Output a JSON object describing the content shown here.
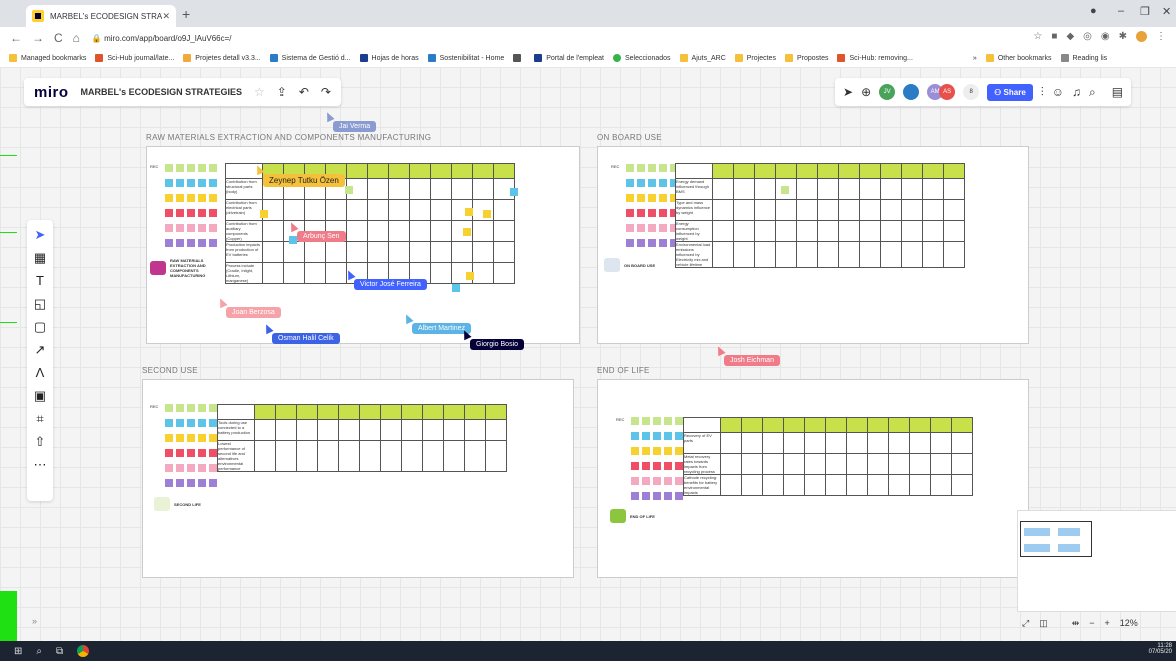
{
  "browser": {
    "tab_title": "MARBEL's ECODESIGN STRATEG",
    "url": "miro.com/app/board/o9J_lAuV66c=/",
    "bookmarks": [
      "Managed bookmarks",
      "Sci-Hub journal/late...",
      "Projetes detall v3.3...",
      "Sistema de Gestió d...",
      "Hojas de horas",
      "Sostenibilitat - Home",
      "Portal de l'empleat",
      "Seleccionados",
      "Ajuts_ARC",
      "Projectes",
      "Propostes",
      "Sci-Hub: removing..."
    ],
    "bookmarks_right": [
      "»",
      "Other bookmarks",
      "Reading lis"
    ]
  },
  "miro": {
    "logo": "miro",
    "board_name": "MARBEL's ECODESIGN STRATEGIES",
    "share_label": "Share",
    "collab_count": "8",
    "collab_initials": [
      "JV",
      "AM",
      "AS"
    ],
    "zoom_level": "12%"
  },
  "frames": {
    "raw": "RAW MATERIALS EXTRACTION AND COMPONENTS MANUFACTURING",
    "onboard": "ON BOARD USE",
    "second": "SECOND USE",
    "eol": "END OF LIFE"
  },
  "section_labels": {
    "raw": "RAW MATERIALS EXTRACTION AND COMPONENTS MANUFACTURING",
    "onboard": "ON BOARD USE",
    "second": "SECOND LIFE",
    "eol": "END OF LIFE"
  },
  "legend_labels": [
    "REC",
    "",
    "",
    "",
    "",
    ""
  ],
  "raw_rows": [
    "Contribution from structural parts (body)",
    "Contribution from electrical parts (drivetrain)",
    "Contribution from auxiliary components (Copper)",
    "Production impacts from production of EV batteries",
    "Process include (Cradle, Inlight, Lithium, manganese)"
  ],
  "onboard_rows": [
    "Energy demand influenced through BMS",
    "Type and mass dynamics influence by weight",
    "Energy consumption influenced by weight",
    "Environmental load emissions influenced by Electricity mix and vehicle lifetime"
  ],
  "second_rows": [
    "Tools during use connected to a battery production",
    "Lowest performance of second life and alternatives environmental performance"
  ],
  "eol_rows": [
    "Recovery of EV parts",
    "Metal recovery rates towards impacts from recycling process",
    "Cathode recycling: benefits for battery environmental impacts"
  ],
  "cursors": [
    {
      "name": "Jai Verma",
      "color": "#8a9bd2"
    },
    {
      "name": "Zeynep Tutku Özen",
      "color": "#f6c13a"
    },
    {
      "name": "Arbunç Sen",
      "color": "#f07c8a"
    },
    {
      "name": "Victor José Ferreira",
      "color": "#4262ff"
    },
    {
      "name": "Joan Berzosa",
      "color": "#f5a3a8"
    },
    {
      "name": "Osman Halil Celik",
      "color": "#3c62e6"
    },
    {
      "name": "Albert Martinez",
      "color": "#5bb4e5"
    },
    {
      "name": "Giorgio Bosio",
      "color": "#050038"
    },
    {
      "name": "Josh Eichman",
      "color": "#f07c8a"
    }
  ],
  "taskbar": {
    "time": "11:28",
    "date": "07/05/20"
  }
}
